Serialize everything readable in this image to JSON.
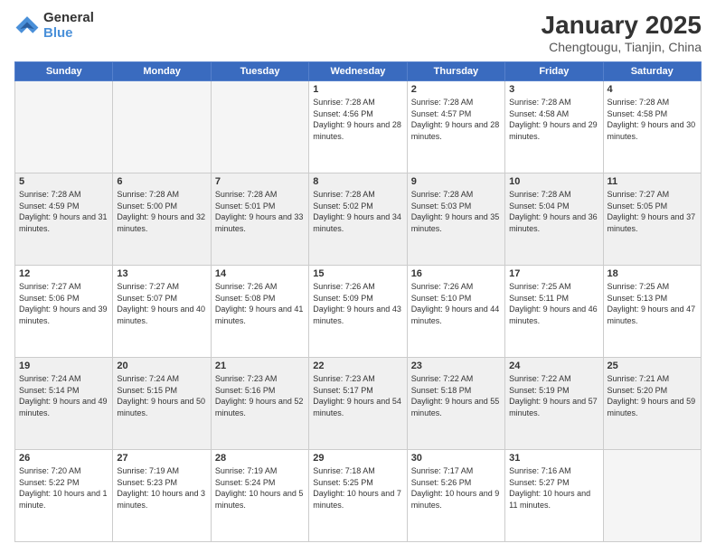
{
  "logo": {
    "line1": "General",
    "line2": "Blue"
  },
  "header": {
    "title": "January 2025",
    "subtitle": "Chengtougu, Tianjin, China"
  },
  "days_of_week": [
    "Sunday",
    "Monday",
    "Tuesday",
    "Wednesday",
    "Thursday",
    "Friday",
    "Saturday"
  ],
  "weeks": [
    {
      "cells": [
        {
          "empty": true
        },
        {
          "empty": true
        },
        {
          "empty": true
        },
        {
          "day": 1,
          "sunrise": "7:28 AM",
          "sunset": "4:56 PM",
          "daylight": "9 hours and 28 minutes."
        },
        {
          "day": 2,
          "sunrise": "7:28 AM",
          "sunset": "4:57 PM",
          "daylight": "9 hours and 28 minutes."
        },
        {
          "day": 3,
          "sunrise": "7:28 AM",
          "sunset": "4:58 AM",
          "daylight": "9 hours and 29 minutes."
        },
        {
          "day": 4,
          "sunrise": "7:28 AM",
          "sunset": "4:58 PM",
          "daylight": "9 hours and 30 minutes."
        }
      ]
    },
    {
      "cells": [
        {
          "day": 5,
          "sunrise": "7:28 AM",
          "sunset": "4:59 PM",
          "daylight": "9 hours and 31 minutes."
        },
        {
          "day": 6,
          "sunrise": "7:28 AM",
          "sunset": "5:00 PM",
          "daylight": "9 hours and 32 minutes."
        },
        {
          "day": 7,
          "sunrise": "7:28 AM",
          "sunset": "5:01 PM",
          "daylight": "9 hours and 33 minutes."
        },
        {
          "day": 8,
          "sunrise": "7:28 AM",
          "sunset": "5:02 PM",
          "daylight": "9 hours and 34 minutes."
        },
        {
          "day": 9,
          "sunrise": "7:28 AM",
          "sunset": "5:03 PM",
          "daylight": "9 hours and 35 minutes."
        },
        {
          "day": 10,
          "sunrise": "7:28 AM",
          "sunset": "5:04 PM",
          "daylight": "9 hours and 36 minutes."
        },
        {
          "day": 11,
          "sunrise": "7:27 AM",
          "sunset": "5:05 PM",
          "daylight": "9 hours and 37 minutes."
        }
      ]
    },
    {
      "cells": [
        {
          "day": 12,
          "sunrise": "7:27 AM",
          "sunset": "5:06 PM",
          "daylight": "9 hours and 39 minutes."
        },
        {
          "day": 13,
          "sunrise": "7:27 AM",
          "sunset": "5:07 PM",
          "daylight": "9 hours and 40 minutes."
        },
        {
          "day": 14,
          "sunrise": "7:26 AM",
          "sunset": "5:08 PM",
          "daylight": "9 hours and 41 minutes."
        },
        {
          "day": 15,
          "sunrise": "7:26 AM",
          "sunset": "5:09 PM",
          "daylight": "9 hours and 43 minutes."
        },
        {
          "day": 16,
          "sunrise": "7:26 AM",
          "sunset": "5:10 PM",
          "daylight": "9 hours and 44 minutes."
        },
        {
          "day": 17,
          "sunrise": "7:25 AM",
          "sunset": "5:11 PM",
          "daylight": "9 hours and 46 minutes."
        },
        {
          "day": 18,
          "sunrise": "7:25 AM",
          "sunset": "5:13 PM",
          "daylight": "9 hours and 47 minutes."
        }
      ]
    },
    {
      "cells": [
        {
          "day": 19,
          "sunrise": "7:24 AM",
          "sunset": "5:14 PM",
          "daylight": "9 hours and 49 minutes."
        },
        {
          "day": 20,
          "sunrise": "7:24 AM",
          "sunset": "5:15 PM",
          "daylight": "9 hours and 50 minutes."
        },
        {
          "day": 21,
          "sunrise": "7:23 AM",
          "sunset": "5:16 PM",
          "daylight": "9 hours and 52 minutes."
        },
        {
          "day": 22,
          "sunrise": "7:23 AM",
          "sunset": "5:17 PM",
          "daylight": "9 hours and 54 minutes."
        },
        {
          "day": 23,
          "sunrise": "7:22 AM",
          "sunset": "5:18 PM",
          "daylight": "9 hours and 55 minutes."
        },
        {
          "day": 24,
          "sunrise": "7:22 AM",
          "sunset": "5:19 PM",
          "daylight": "9 hours and 57 minutes."
        },
        {
          "day": 25,
          "sunrise": "7:21 AM",
          "sunset": "5:20 PM",
          "daylight": "9 hours and 59 minutes."
        }
      ]
    },
    {
      "cells": [
        {
          "day": 26,
          "sunrise": "7:20 AM",
          "sunset": "5:22 PM",
          "daylight": "10 hours and 1 minute."
        },
        {
          "day": 27,
          "sunrise": "7:19 AM",
          "sunset": "5:23 PM",
          "daylight": "10 hours and 3 minutes."
        },
        {
          "day": 28,
          "sunrise": "7:19 AM",
          "sunset": "5:24 PM",
          "daylight": "10 hours and 5 minutes."
        },
        {
          "day": 29,
          "sunrise": "7:18 AM",
          "sunset": "5:25 PM",
          "daylight": "10 hours and 7 minutes."
        },
        {
          "day": 30,
          "sunrise": "7:17 AM",
          "sunset": "5:26 PM",
          "daylight": "10 hours and 9 minutes."
        },
        {
          "day": 31,
          "sunrise": "7:16 AM",
          "sunset": "5:27 PM",
          "daylight": "10 hours and 11 minutes."
        },
        {
          "empty": true
        }
      ]
    }
  ]
}
